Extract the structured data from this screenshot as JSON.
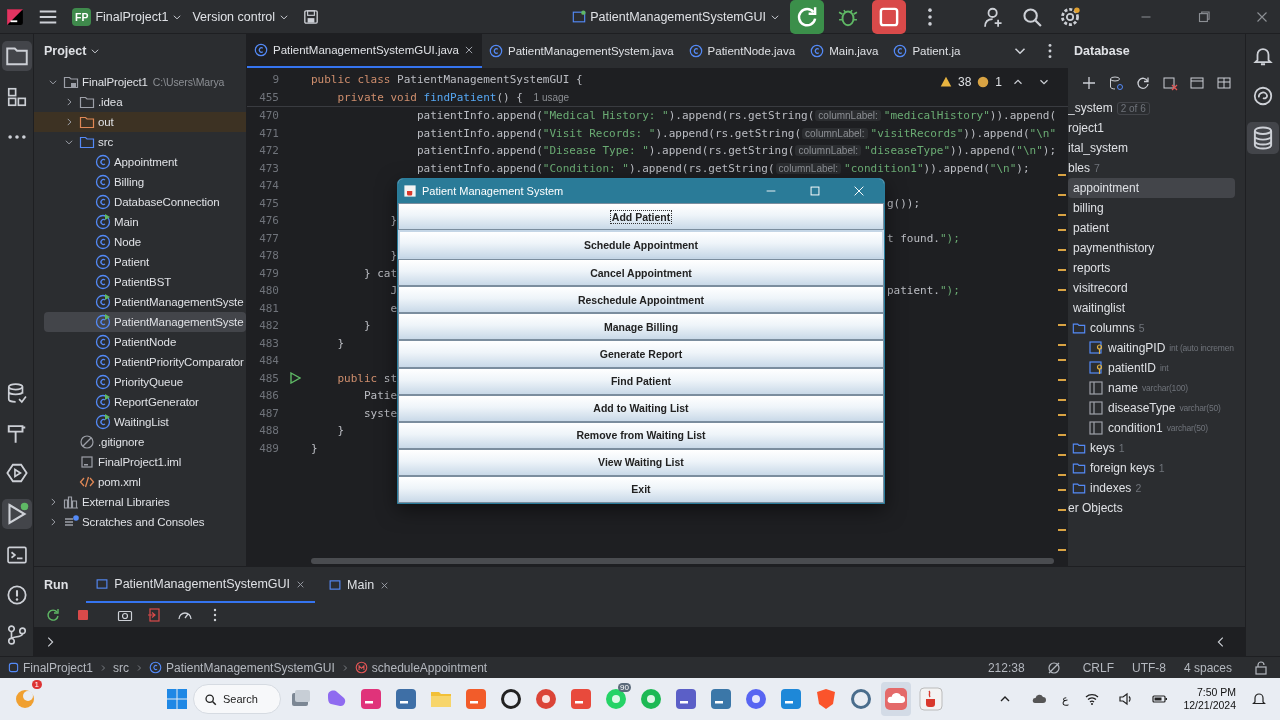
{
  "toolbar": {
    "project_badge": "FP",
    "project": "FinalProject1",
    "vcs": "Version control",
    "run_config": "PatientManagementSystemGUI"
  },
  "project_panel": {
    "title": "Project",
    "tree": [
      {
        "label": "FinalProject1",
        "kind": "module",
        "path": "C:\\Users\\Marya",
        "expanded": true,
        "selected": false,
        "children": [
          {
            "label": ".idea",
            "kind": "folder",
            "expanded": false,
            "selected": false
          },
          {
            "label": "out",
            "kind": "excluded-folder",
            "expanded": false,
            "selected": false
          },
          {
            "label": "src",
            "kind": "source-folder",
            "expanded": true,
            "selected": false,
            "children": [
              {
                "label": "Appointment",
                "kind": "class",
                "selected": false
              },
              {
                "label": "Billing",
                "kind": "class",
                "selected": false
              },
              {
                "label": "DatabaseConnection",
                "kind": "class",
                "selected": false
              },
              {
                "label": "Main",
                "kind": "main-class",
                "selected": false
              },
              {
                "label": "Node",
                "kind": "class",
                "selected": false
              },
              {
                "label": "Patient",
                "kind": "class",
                "selected": false
              },
              {
                "label": "PatientBST",
                "kind": "class",
                "selected": false
              },
              {
                "label": "PatientManagementSyste",
                "kind": "main-class",
                "selected": false
              },
              {
                "label": "PatientManagementSyste",
                "kind": "main-class",
                "selected": true
              },
              {
                "label": "PatientNode",
                "kind": "class",
                "selected": false
              },
              {
                "label": "PatientPriorityComparator",
                "kind": "class",
                "selected": false
              },
              {
                "label": "PriorityQueue",
                "kind": "class",
                "selected": false
              },
              {
                "label": "ReportGenerator",
                "kind": "main-class",
                "selected": false
              },
              {
                "label": "WaitingList",
                "kind": "main-class",
                "selected": false
              }
            ]
          },
          {
            "label": ".gitignore",
            "kind": "ignore-file",
            "selected": false
          },
          {
            "label": "FinalProject1.iml",
            "kind": "iml-file",
            "selected": false
          },
          {
            "label": "pom.xml",
            "kind": "xml-file",
            "selected": false
          }
        ]
      },
      {
        "label": "External Libraries",
        "kind": "libraries",
        "expanded": false,
        "selected": false
      },
      {
        "label": "Scratches and Consoles",
        "kind": "scratches",
        "expanded": false,
        "selected": false
      }
    ]
  },
  "editor": {
    "tabs": [
      {
        "label": "PatientManagementSystemGUI.java",
        "selected": true
      },
      {
        "label": "PatientManagementSystem.java",
        "selected": false
      },
      {
        "label": "PatientNode.java",
        "selected": false
      },
      {
        "label": "Main.java",
        "selected": false
      },
      {
        "label": "Patient.ja",
        "selected": false
      }
    ],
    "inspections": {
      "warnings": "38",
      "weak_warnings": "1"
    },
    "sticky_lines": [
      {
        "number": "9",
        "parts": [
          {
            "kind": "code",
            "text": "public class PatientManagementSystemGUI {"
          }
        ]
      },
      {
        "number": "455",
        "parts": [
          {
            "kind": "code",
            "text": "    private void findPatient() { "
          },
          {
            "kind": "hint",
            "text": "1 usage"
          }
        ]
      }
    ],
    "lines": [
      {
        "number": "470",
        "parts": [
          {
            "kind": "code",
            "text": "                patientInfo.append(\"Medical History: \").append(rs.getString("
          },
          {
            "kind": "hint",
            "text": "columnLabel:"
          },
          {
            "kind": "code",
            "text": "\"medicalHistory\")).append("
          }
        ]
      },
      {
        "number": "471",
        "parts": [
          {
            "kind": "code",
            "text": "                patientInfo.append(\"Visit Records: \").append(rs.getString("
          },
          {
            "kind": "hint",
            "text": "columnLabel:"
          },
          {
            "kind": "code",
            "text": "\"visitRecords\")).append(\"\\n\""
          }
        ]
      },
      {
        "number": "472",
        "parts": [
          {
            "kind": "code",
            "text": "                patientInfo.append(\"Disease Type: \").append(rs.getString("
          },
          {
            "kind": "hint",
            "text": "columnLabel:"
          },
          {
            "kind": "code",
            "text": "\"diseaseType\")).append(\"\\n\");"
          }
        ]
      },
      {
        "number": "473",
        "parts": [
          {
            "kind": "code",
            "text": "                patientInfo.append(\"Condition: \").append(rs.getString("
          },
          {
            "kind": "hint",
            "text": "columnLabel:"
          },
          {
            "kind": "code",
            "text": "\"condition1\")).append(\"\\n\");"
          }
        ]
      },
      {
        "number": "474"
      },
      {
        "number": "475",
        "right": "g());"
      },
      {
        "number": "476",
        "left": "            }"
      },
      {
        "number": "477",
        "right": "t found.\");"
      },
      {
        "number": "478",
        "left": "            }"
      },
      {
        "number": "479",
        "left": "        } cat"
      },
      {
        "number": "480",
        "left": "            J",
        "right": "patient.\");"
      },
      {
        "number": "481",
        "left": "            e"
      },
      {
        "number": "482",
        "left": "        }"
      },
      {
        "number": "483",
        "left": "    }"
      },
      {
        "number": "484"
      },
      {
        "number": "485",
        "left": "    public st",
        "runnable": true
      },
      {
        "number": "486",
        "left": "        Patie"
      },
      {
        "number": "487",
        "left": "        syste"
      },
      {
        "number": "488",
        "left": "    }"
      },
      {
        "number": "489",
        "left": "}"
      }
    ]
  },
  "dialog": {
    "title": "Patient Management System",
    "buttons": [
      {
        "label": "Add Patient",
        "focused": true,
        "hovered": false
      },
      {
        "label": "Schedule Appointment",
        "focused": false,
        "hovered": true
      },
      {
        "label": "Cancel Appointment",
        "focused": false,
        "hovered": false
      },
      {
        "label": "Reschedule Appointment",
        "focused": false,
        "hovered": false
      },
      {
        "label": "Manage Billing",
        "focused": false,
        "hovered": false
      },
      {
        "label": "Generate Report",
        "focused": false,
        "hovered": false
      },
      {
        "label": "Find Patient",
        "focused": false,
        "hovered": false
      },
      {
        "label": "Add to Waiting List",
        "focused": false,
        "hovered": false
      },
      {
        "label": "Remove from Waiting List",
        "focused": false,
        "hovered": false
      },
      {
        "label": "View Waiting List",
        "focused": false,
        "hovered": false
      },
      {
        "label": "Exit",
        "focused": false,
        "hovered": false
      }
    ]
  },
  "database_panel": {
    "title": "Database",
    "tree": [
      {
        "label": "_system",
        "badge": "2 of 6",
        "selected": false
      },
      {
        "label": "roject1",
        "selected": false
      },
      {
        "label": "ital_system",
        "selected": false
      },
      {
        "label": "bles",
        "count": "7",
        "selected": false,
        "children": [
          {
            "label": "appointment",
            "selected": true
          },
          {
            "label": "billing",
            "selected": false
          },
          {
            "label": "patient",
            "selected": false
          },
          {
            "label": "paymenthistory",
            "selected": false
          },
          {
            "label": "reports",
            "selected": false
          },
          {
            "label": "visitrecord",
            "selected": false
          },
          {
            "label": "waitinglist",
            "selected": false,
            "children": [
              {
                "label": "columns",
                "kind": "folder",
                "count": "5",
                "selected": false,
                "children": [
                  {
                    "label": "waitingPID",
                    "kind": "key-column",
                    "type": "int (auto incremen",
                    "selected": false
                  },
                  {
                    "label": "patientID",
                    "kind": "key-column",
                    "type": "int",
                    "selected": false
                  },
                  {
                    "label": "name",
                    "kind": "column",
                    "type": "varchar(100)",
                    "selected": false
                  },
                  {
                    "label": "diseaseType",
                    "kind": "column",
                    "type": "varchar(50)",
                    "selected": false
                  },
                  {
                    "label": "condition1",
                    "kind": "column",
                    "type": "varchar(50)",
                    "selected": false
                  }
                ]
              },
              {
                "label": "keys",
                "kind": "folder",
                "count": "1",
                "selected": false
              },
              {
                "label": "foreign keys",
                "kind": "folder",
                "count": "1",
                "selected": false
              },
              {
                "label": "indexes",
                "kind": "folder",
                "count": "2",
                "selected": false
              }
            ]
          }
        ]
      },
      {
        "label": "er Objects",
        "selected": false
      }
    ]
  },
  "run_panel": {
    "title": "Run",
    "tabs": [
      {
        "label": "PatientManagementSystemGUI",
        "selected": true
      },
      {
        "label": "Main",
        "selected": false
      }
    ]
  },
  "status_bar": {
    "breadcrumbs": [
      {
        "label": "FinalProject1",
        "kind": "module"
      },
      {
        "label": "src",
        "kind": "folder"
      },
      {
        "label": "PatientManagementSystemGUI",
        "kind": "class"
      },
      {
        "label": "scheduleAppointment",
        "kind": "method"
      }
    ],
    "position": "212:38",
    "line_separator": "CRLF",
    "encoding": "UTF-8",
    "indent": "4 spaces"
  },
  "taskbar": {
    "widget_badge": "1",
    "search": "Search",
    "apps": [
      {
        "kind": "files",
        "selected": false
      },
      {
        "kind": "copilot",
        "selected": false
      },
      {
        "kind": "intellij",
        "selected": false
      },
      {
        "kind": "workbench",
        "selected": false
      },
      {
        "kind": "explorer",
        "selected": false
      },
      {
        "kind": "jetbrains",
        "selected": false
      },
      {
        "kind": "chatgpt",
        "selected": false
      },
      {
        "kind": "chrome",
        "selected": false
      },
      {
        "kind": "wps",
        "selected": false
      },
      {
        "kind": "whatsapp",
        "selected": false,
        "badge": "90"
      },
      {
        "kind": "spotify",
        "selected": false
      },
      {
        "kind": "teams",
        "selected": false
      },
      {
        "kind": "python",
        "selected": false
      },
      {
        "kind": "discord",
        "selected": false
      },
      {
        "kind": "vscode",
        "selected": false
      },
      {
        "kind": "brave",
        "selected": false
      },
      {
        "kind": "network",
        "selected": false
      },
      {
        "kind": "cloud",
        "selected": true
      },
      {
        "kind": "java",
        "selected": false
      }
    ],
    "input_language": "ع",
    "time": "7:50 PM",
    "date": "12/21/2024"
  }
}
